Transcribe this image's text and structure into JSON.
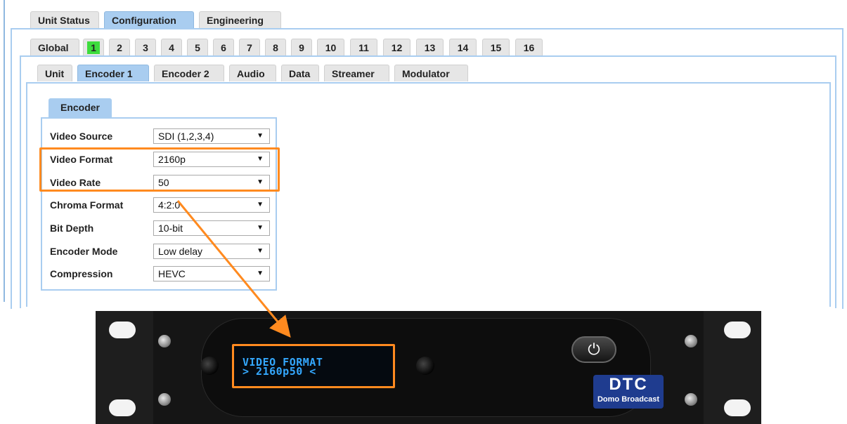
{
  "top_tabs": [
    {
      "label": "Unit Status",
      "active": false
    },
    {
      "label": "Configuration",
      "active": true
    },
    {
      "label": "Engineering",
      "active": false
    }
  ],
  "channel_tabs": {
    "global_label": "Global",
    "channels": [
      "1",
      "2",
      "3",
      "4",
      "5",
      "6",
      "7",
      "8",
      "9",
      "10",
      "11",
      "12",
      "13",
      "14",
      "15",
      "16"
    ],
    "active": "1",
    "active_color": "#3ddc3d"
  },
  "sub_tabs": [
    {
      "label": "Unit",
      "active": false
    },
    {
      "label": "Encoder 1",
      "active": true
    },
    {
      "label": "Encoder 2",
      "active": false
    },
    {
      "label": "Audio",
      "active": false
    },
    {
      "label": "Data",
      "active": false
    },
    {
      "label": "Streamer",
      "active": false
    },
    {
      "label": "Modulator",
      "active": false
    }
  ],
  "encoder": {
    "section_label": "Encoder",
    "fields": [
      {
        "label": "Video Source",
        "value": "SDI (1,2,3,4)"
      },
      {
        "label": "Video Format",
        "value": "2160p"
      },
      {
        "label": "Video Rate",
        "value": "50"
      },
      {
        "label": "Chroma Format",
        "value": "4:2:0"
      },
      {
        "label": "Bit Depth",
        "value": "10-bit"
      },
      {
        "label": "Encoder Mode",
        "value": "Low delay"
      },
      {
        "label": "Compression",
        "value": "HEVC"
      }
    ]
  },
  "device": {
    "lcd_line1": "VIDEO FORMAT",
    "lcd_line2": "> 2160p50 <",
    "power_symbol": "⏻",
    "logo_main": "DTC",
    "logo_sub": "Domo Broadcast"
  },
  "colors": {
    "highlight": "#ff8a1f",
    "tab_active": "#a9cdf0",
    "lcd_text": "#34a8ff"
  }
}
